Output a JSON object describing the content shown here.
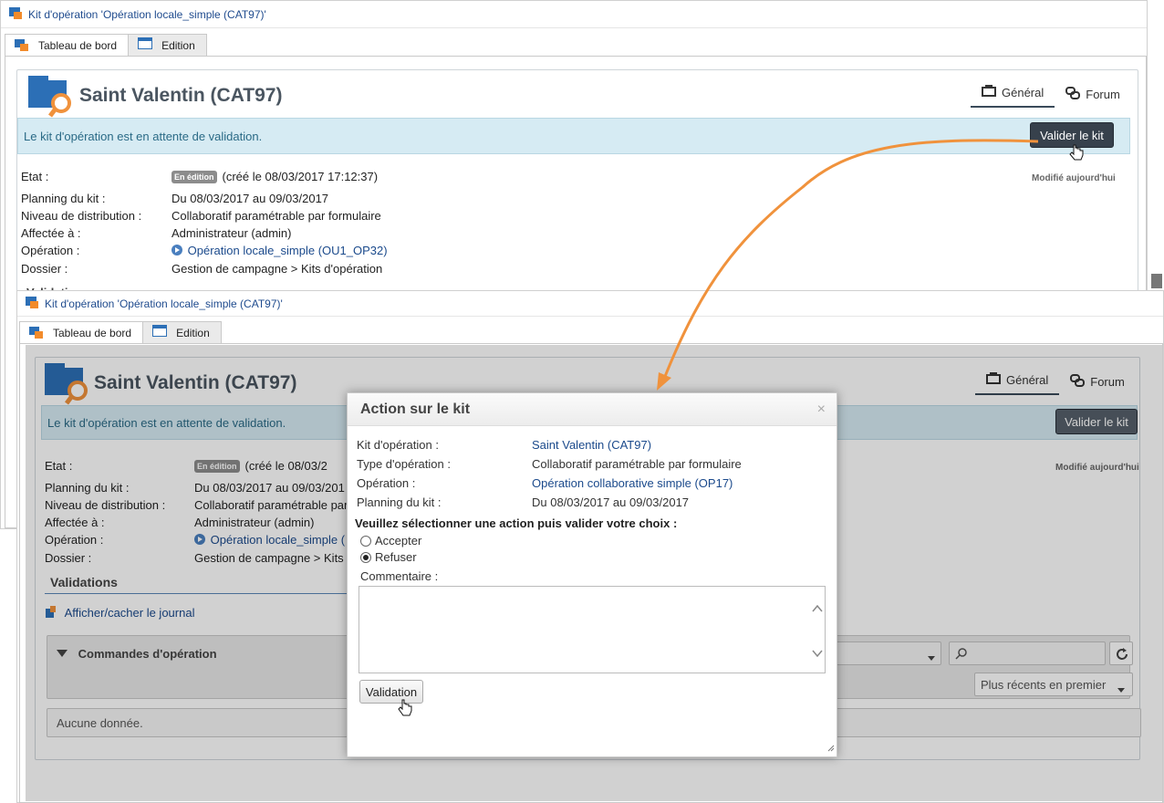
{
  "window": {
    "title": "Kit d'opération 'Opération locale_simple (CAT97)'",
    "tabs": [
      {
        "label": "Tableau de bord"
      },
      {
        "label": "Edition"
      }
    ]
  },
  "header": {
    "title": "Saint Valentin (CAT97)",
    "nav": [
      {
        "label": "Général"
      },
      {
        "label": "Forum"
      }
    ]
  },
  "banner": {
    "message": "Le kit d'opération est en attente de validation.",
    "button": "Valider le kit"
  },
  "modified": "Modifié aujourd'hui",
  "details": {
    "etat": {
      "label": "Etat :",
      "badge": "En édition",
      "value": "(créé le 08/03/2017 17:12:37)",
      "value_short": "(créé le 08/03/2"
    },
    "planning": {
      "label": "Planning du kit :",
      "value": "Du 08/03/2017 au 09/03/2017",
      "value_short": "Du 08/03/2017 au 09/03/201"
    },
    "niveau": {
      "label": "Niveau de distribution :",
      "value": "Collaboratif paramétrable par formulaire",
      "value_short": "Collaboratif paramétrable par"
    },
    "affectee": {
      "label": "Affectée à :",
      "value": "Administrateur (admin)"
    },
    "operation": {
      "label": "Opération :",
      "value": "Opération locale_simple (OU1_OP32)",
      "value_short": "Opération locale_simple ("
    },
    "dossier": {
      "label": "Dossier :",
      "value": "Gestion de campagne > Kits d'opération",
      "value_short": "Gestion de campagne > Kits"
    }
  },
  "validations": {
    "title": "Validations",
    "title_cut": "Validations",
    "toggle_log": "Afficher/cacher le journal",
    "commands": "Commandes d'opération",
    "sort": "Plus récents en premier",
    "empty": "Aucune donnée."
  },
  "modal": {
    "title": "Action sur le kit",
    "close": "×",
    "fields": [
      {
        "label": "Kit d'opération :",
        "value": "Saint Valentin (CAT97)",
        "link": true
      },
      {
        "label": "Type d'opération :",
        "value": "Collaboratif paramétrable par formulaire",
        "link": false
      },
      {
        "label": "Opération :",
        "value": "Opération collaborative simple (OP17)",
        "link": true
      },
      {
        "label": "Planning du kit :",
        "value": "Du 08/03/2017 au 09/03/2017",
        "link": false
      }
    ],
    "prompt": "Veuillez sélectionner une action puis valider votre choix :",
    "options": [
      {
        "label": "Accepter",
        "selected": false
      },
      {
        "label": "Refuser",
        "selected": true
      }
    ],
    "comment_label": "Commentaire :",
    "submit": "Validation"
  },
  "colors": {
    "accent": "#1b4a8c",
    "arrow": "#f0923c",
    "banner": "#d6ebf3",
    "dark_button": "#37414c"
  }
}
